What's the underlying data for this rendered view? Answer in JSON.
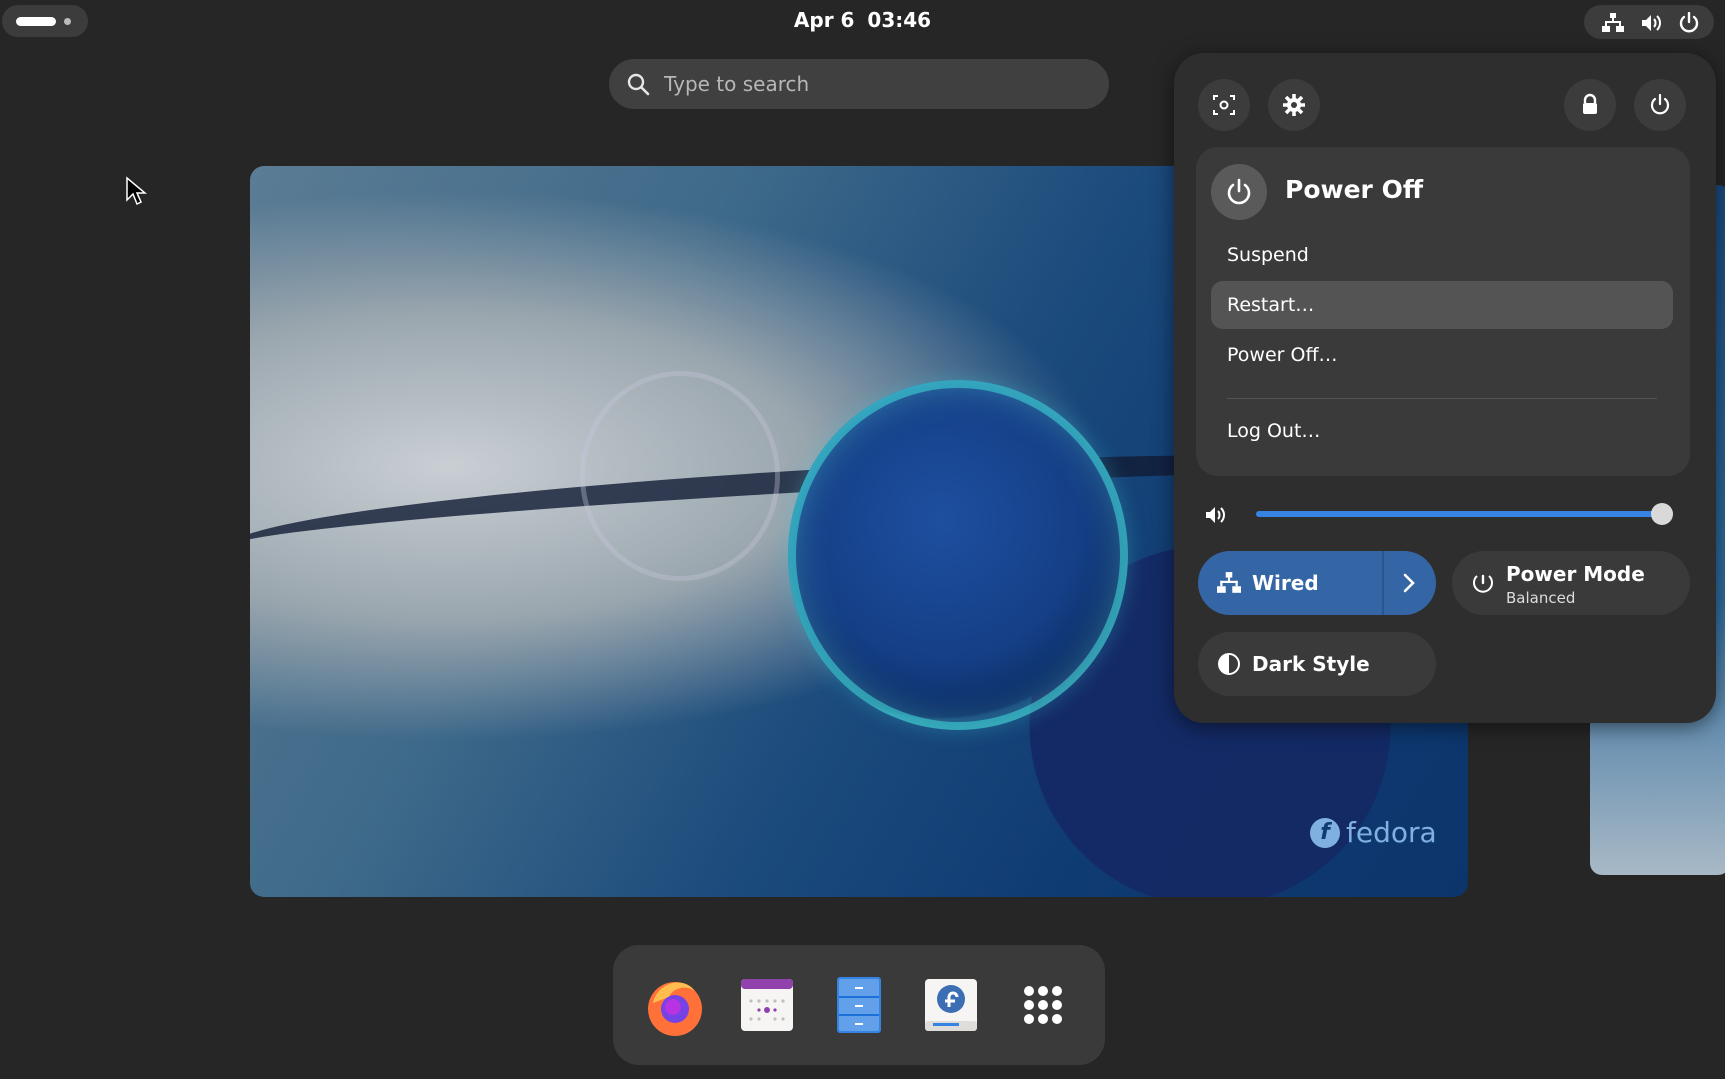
{
  "topbar": {
    "clock_date": "Apr 6",
    "clock_time": "03:46"
  },
  "search": {
    "placeholder": "Type to search"
  },
  "workspace": {
    "wallpaper_brand": "fedora"
  },
  "dock": {
    "apps": [
      "Firefox",
      "Calendar",
      "Files",
      "Software",
      "Show Apps"
    ]
  },
  "quick_settings": {
    "power_menu": {
      "title": "Power Off",
      "items": [
        "Suspend",
        "Restart…",
        "Power Off…",
        "Log Out…"
      ],
      "highlighted": "Restart…"
    },
    "volume_level": 0.98,
    "tiles": {
      "wired": "Wired",
      "power_mode": "Power Mode",
      "power_mode_sub": "Balanced",
      "dark_style": "Dark Style"
    }
  },
  "colors": {
    "accent": "#3584e4",
    "wired_tile": "#3465a4",
    "panel": "#2e2e2e",
    "background": "#262626"
  }
}
